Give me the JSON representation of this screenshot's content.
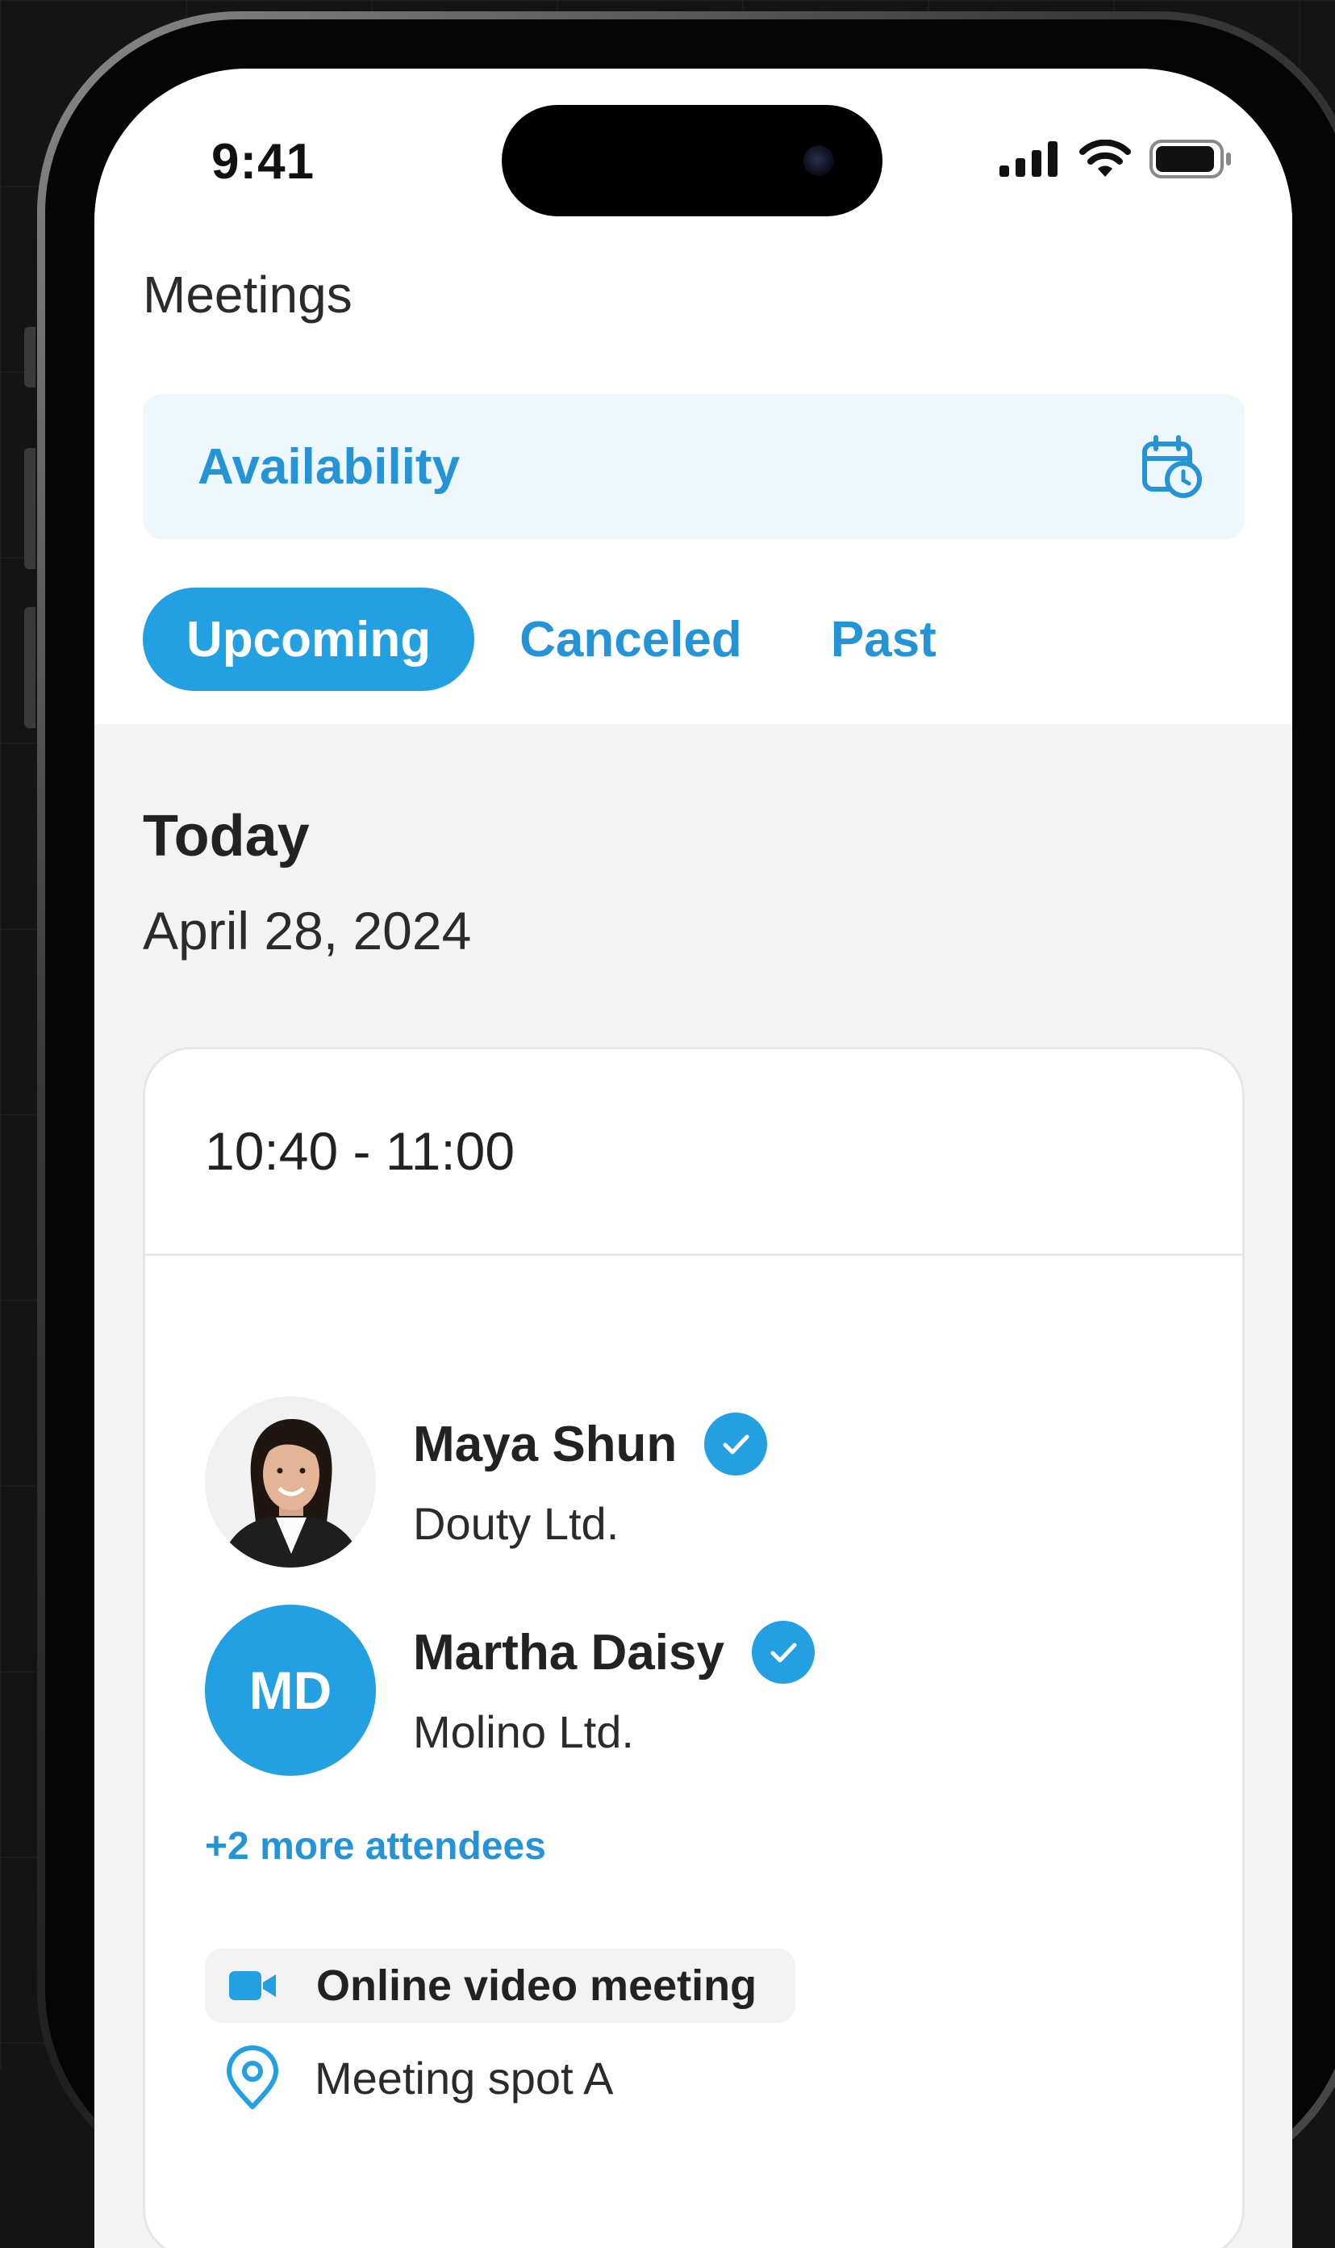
{
  "status_bar": {
    "time": "9:41",
    "icons": [
      "signal-icon",
      "wifi-icon",
      "battery-icon"
    ]
  },
  "header": {
    "title": "Meetings"
  },
  "availability": {
    "label": "Availability",
    "icon": "calendar-clock-icon"
  },
  "tabs": [
    {
      "label": "Upcoming",
      "active": true
    },
    {
      "label": "Canceled",
      "active": false
    },
    {
      "label": "Past",
      "active": false
    }
  ],
  "day": {
    "label": "Today",
    "date": "April 28, 2024"
  },
  "meeting": {
    "time": "10:40 - 11:00",
    "attendees": [
      {
        "name": "Maya Shun",
        "company": "Douty Ltd.",
        "avatar": "photo",
        "verified": true
      },
      {
        "name": "Martha Daisy",
        "company": "Molino Ltd.",
        "avatar": "initials",
        "initials": "MD",
        "verified": true
      }
    ],
    "more_attendees": "+2 more attendees",
    "type": "Online video meeting",
    "location": "Meeting spot A"
  },
  "colors": {
    "accent": "#22a0e2",
    "accent_text": "#2494d6",
    "availability_bg": "#eef7fc"
  }
}
